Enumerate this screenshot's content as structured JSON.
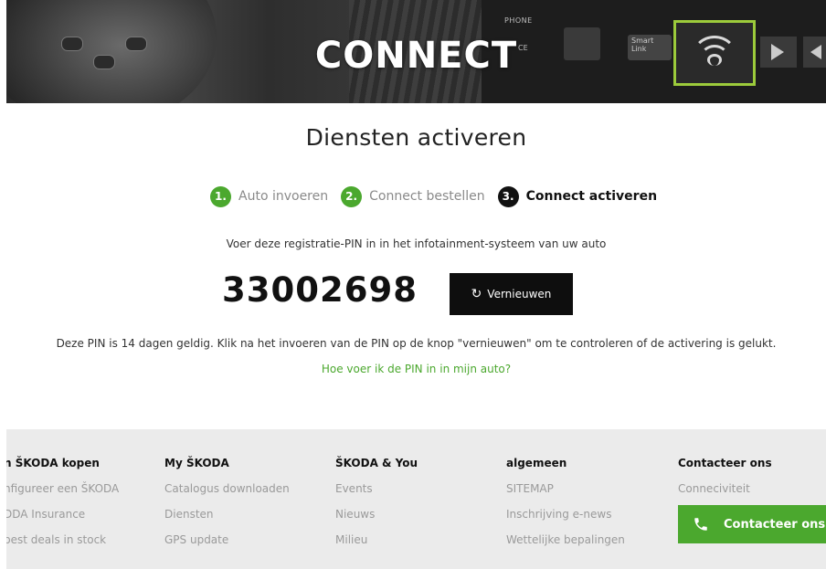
{
  "hero": {
    "title": "CONNECT",
    "panel_label_phone": "PHONE",
    "panel_label_small": "CE",
    "tile_smartlink": "Smart Link"
  },
  "main": {
    "title": "Diensten activeren",
    "steps": [
      {
        "number": "1.",
        "label": "Auto invoeren",
        "state": "done"
      },
      {
        "number": "2.",
        "label": "Connect bestellen",
        "state": "done"
      },
      {
        "number": "3.",
        "label": "Connect activeren",
        "state": "active"
      }
    ],
    "instruction": "Voer deze registratie-PIN in in het infotainment-systeem van uw auto",
    "pin": "33002698",
    "refresh_label": "Vernieuwen",
    "note": "Deze PIN is 14 dagen geldig. Klik na het invoeren van de PIN op de knop \"vernieuwen\" om te controleren of de activering is gelukt.",
    "help_link": "Hoe voer ik de PIN in in mijn auto?"
  },
  "footer": {
    "columns": [
      {
        "heading": "n ŠKODA kopen",
        "links": [
          "nfigureer een ŠKODA",
          "DDA Insurance",
          "best deals in stock"
        ]
      },
      {
        "heading": "My ŠKODA",
        "links": [
          "Catalogus downloaden",
          "Diensten",
          "GPS update"
        ]
      },
      {
        "heading": "ŠKODA & You",
        "links": [
          "Events",
          "Nieuws",
          "Milieu"
        ]
      },
      {
        "heading": "algemeen",
        "links": [
          "SITEMAP",
          "Inschrijving e-news",
          "Wettelijke bepalingen"
        ]
      },
      {
        "heading": "Contacteer ons",
        "links": [
          "Conneciviteit"
        ]
      }
    ],
    "contact_button": "Contacteer ons"
  },
  "colors": {
    "accent_green": "#4ba82e",
    "step_active": "#111111",
    "button_dark": "#0e0e0e",
    "footer_bg": "#ebebeb"
  },
  "icons": {
    "refresh": "refresh-icon",
    "phone": "phone-icon",
    "wifi": "wifi-icon"
  }
}
